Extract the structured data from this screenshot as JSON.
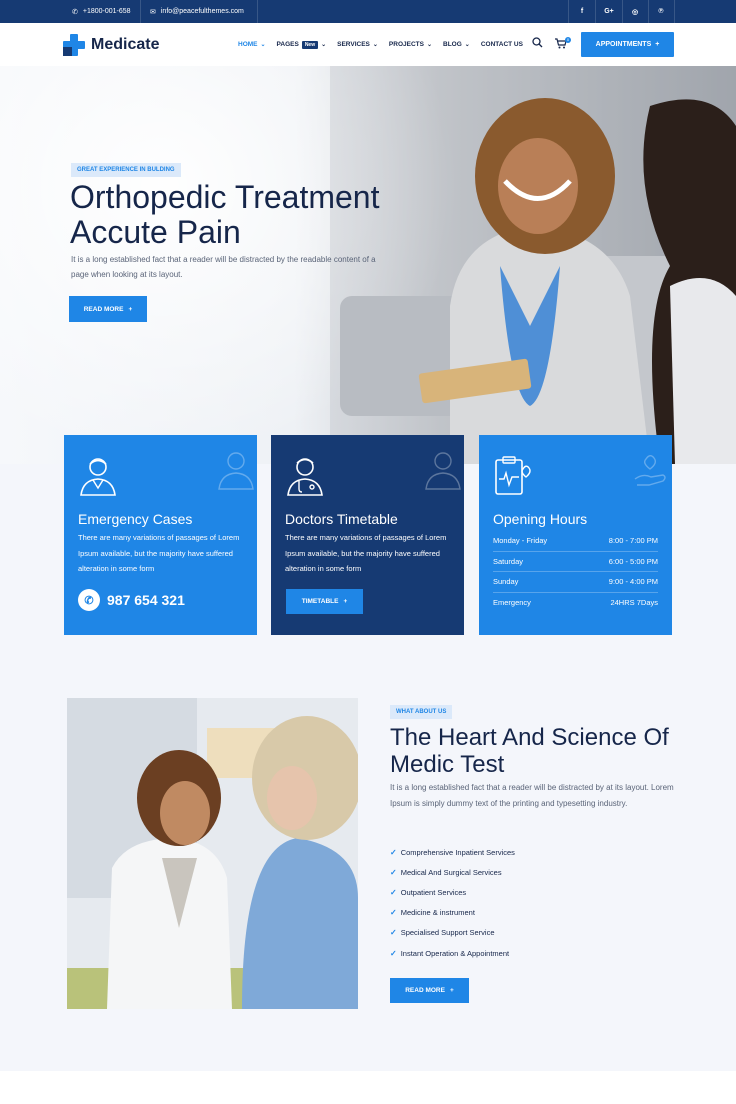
{
  "topbar": {
    "phone": "+1800-001-658",
    "email": "info@peacefulthemes.com",
    "social": [
      {
        "icon": "facebook-icon",
        "glyph": "f"
      },
      {
        "icon": "google-plus-icon",
        "glyph": "G+"
      },
      {
        "icon": "instagram-icon",
        "glyph": "◎"
      },
      {
        "icon": "pinterest-icon",
        "glyph": "℗"
      }
    ]
  },
  "header": {
    "brand": "Medicate",
    "nav": [
      {
        "label": "HOME",
        "active": true
      },
      {
        "label": "PAGES",
        "badge": "New"
      },
      {
        "label": "SERVICES"
      },
      {
        "label": "PROJECTS"
      },
      {
        "label": "BLOG"
      },
      {
        "label": "CONTACT US"
      }
    ],
    "cart_count": "0",
    "cta": "APPOINTMENTS"
  },
  "hero": {
    "tag": "GREAT EXPERIENCE IN BULDING",
    "title": "Orthopedic Treatment Accute Pain",
    "text": "It is a long established fact that a reader will be distracted by the readable content of a page when looking at its layout.",
    "button": "READ MORE"
  },
  "cards": {
    "emergency": {
      "title": "Emergency Cases",
      "text": "There are many variations of passages of Lorem Ipsum available, but the majority have suffered alteration in some form",
      "phone": "987 654 321"
    },
    "timetable": {
      "title": "Doctors Timetable",
      "text": "There are many variations of passages of Lorem Ipsum available, but the majority have suffered alteration in some form",
      "button": "TIMETABLE"
    },
    "hours": {
      "title": "Opening Hours",
      "rows": [
        {
          "day": "Monday - Friday",
          "time": "8:00 - 7:00 PM"
        },
        {
          "day": "Saturday",
          "time": "6:00 - 5:00 PM"
        },
        {
          "day": "Sunday",
          "time": "9:00 - 4:00 PM"
        },
        {
          "day": "Emergency",
          "time": "24HRS 7Days"
        }
      ]
    }
  },
  "about": {
    "tag": "WHAT ABOUT US",
    "title": "The Heart And Science Of Medic Test",
    "text": "It is a long established fact that a reader will be distracted by at its layout. Lorem Ipsum is simply dummy text of the printing and typesetting industry.",
    "features": [
      "Comprehensive Inpatient Services",
      "Medical And Surgical Services",
      "Outpatient Services",
      "Medicine & instrument",
      "Specialised Support Service",
      "Instant Operation & Appointment"
    ],
    "button": "READ MORE"
  },
  "colors": {
    "primary": "#1f86e6",
    "dark": "#163a73",
    "text": "#16264a"
  }
}
